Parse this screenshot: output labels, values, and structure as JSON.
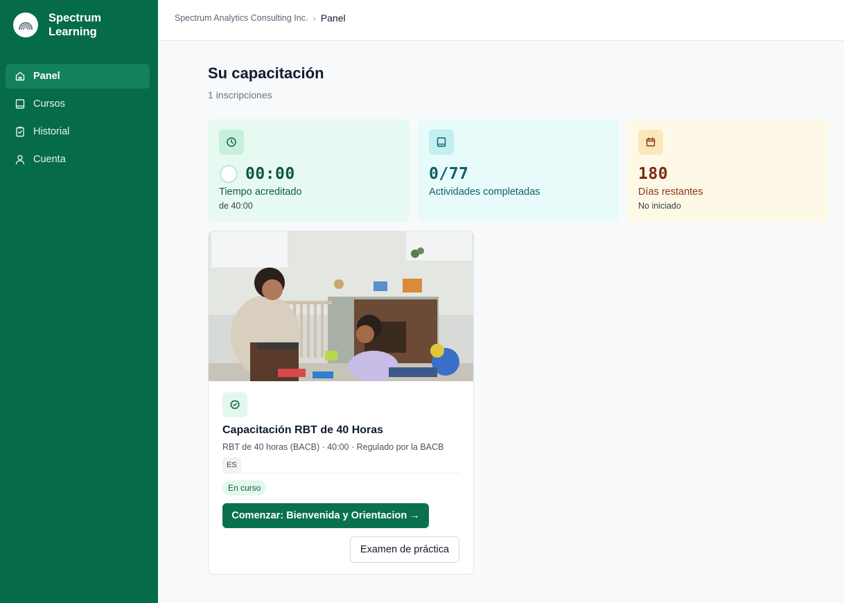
{
  "brand": {
    "name": "Spectrum Learning",
    "logo": "rainbow-logo"
  },
  "sidebar": {
    "items": [
      {
        "label": "Panel",
        "icon": "home-icon",
        "active": true
      },
      {
        "label": "Cursos",
        "icon": "book-icon",
        "active": false
      },
      {
        "label": "Historial",
        "icon": "clipboard-check-icon",
        "active": false
      },
      {
        "label": "Cuenta",
        "icon": "user-icon",
        "active": false
      }
    ]
  },
  "breadcrumb": {
    "org": "Spectrum Analytics Consulting Inc.",
    "separator": "›",
    "current": "Panel"
  },
  "main": {
    "title": "Su capacitación",
    "subtitle": "1 inscripciones"
  },
  "stats": [
    {
      "icon": "clock-icon",
      "value": "00:00",
      "label": "Tiempo acreditado",
      "note": "de 40:00",
      "progress": 0
    },
    {
      "icon": "book-icon",
      "value": "0/77",
      "label": "Actividades completadas"
    },
    {
      "icon": "calendar-icon",
      "value": "180",
      "label": "Días restantes",
      "note": "No iniciado"
    }
  ],
  "course": {
    "icon": "badge-check-icon",
    "title": "Capacitación RBT de 40 Horas",
    "meta": "RBT de 40 horas (BACB) · 40:00 · Regulado por la BACB",
    "language": "ES",
    "status": "En curso",
    "primary_action": "Comenzar: Bienvenida y Orientacion →",
    "secondary_action": "Examen de práctica"
  },
  "colors": {
    "sidebar_bg": "#066b4a",
    "sidebar_active": "#138159",
    "primary_button": "#0a7150"
  }
}
